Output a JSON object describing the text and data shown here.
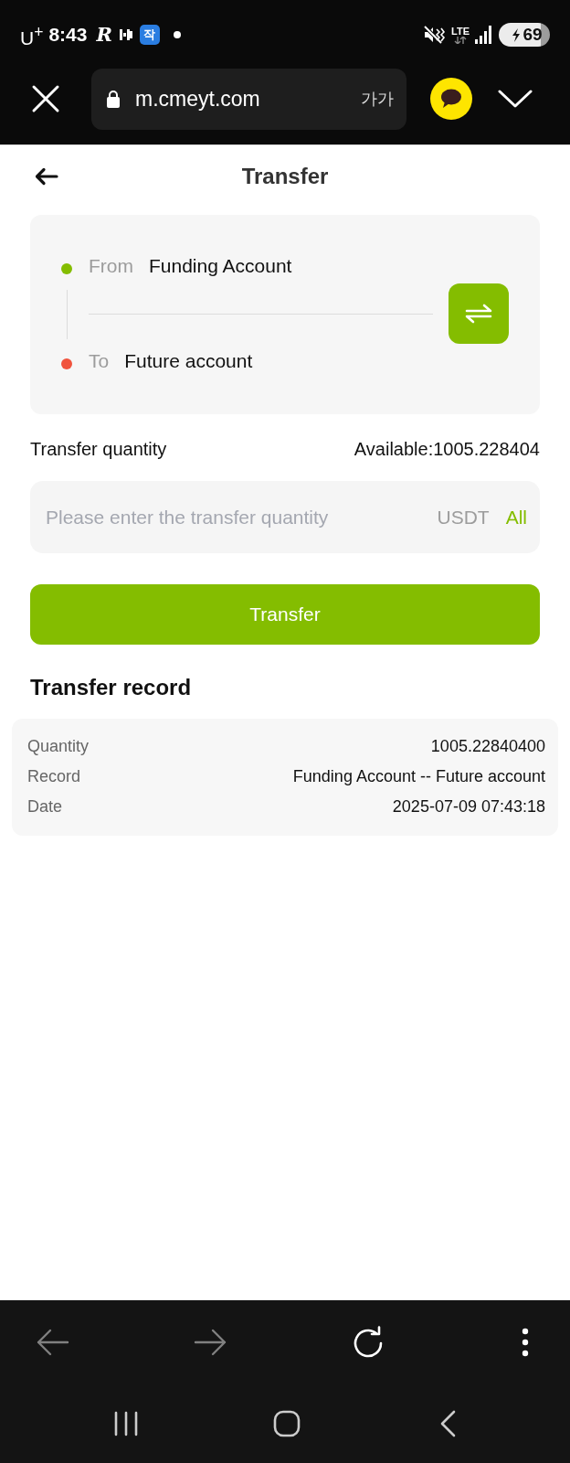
{
  "status_bar": {
    "carrier": "U$^{+}$",
    "time": "8:43",
    "app_letter": "R",
    "app_badge": "작",
    "network": "LTE",
    "battery": "69"
  },
  "browser": {
    "url": "m.cmeyt.com",
    "text_size": "가가"
  },
  "header": {
    "title": "Transfer"
  },
  "route": [
    {
      "label": "From",
      "value": "Funding Account",
      "color": "#84bd00"
    },
    {
      "label": "To",
      "value": "Future account",
      "color": "#f0533d"
    }
  ],
  "quantity": {
    "label": "Transfer quantity",
    "available": "Available:1005.228404",
    "placeholder": "Please enter the transfer quantity",
    "unit": "USDT",
    "all": "All"
  },
  "submit": "Transfer",
  "records": {
    "title": "Transfer record",
    "items": [
      {
        "fields": [
          {
            "label": "Quantity",
            "value": "1005.22840400"
          },
          {
            "label": "Record",
            "value": "Funding Account -- Future account"
          },
          {
            "label": "Date",
            "value": "2025-07-09 07:43:18"
          }
        ]
      }
    ]
  },
  "browser_toolbar": [
    {
      "kind": "back",
      "disabled": true
    },
    {
      "kind": "forward",
      "disabled": true
    },
    {
      "kind": "reload",
      "disabled": false
    },
    {
      "kind": "menu",
      "disabled": false
    }
  ]
}
